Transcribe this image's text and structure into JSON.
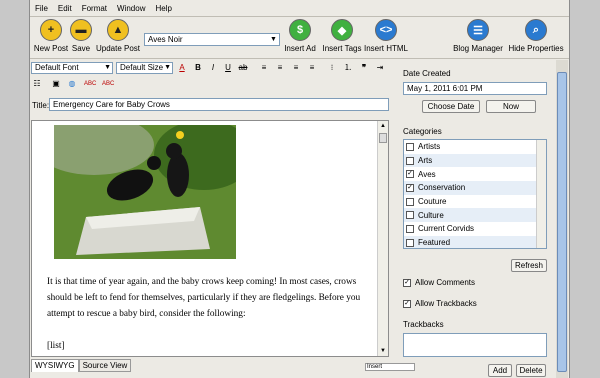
{
  "menu": [
    "File",
    "Edit",
    "Format",
    "Window",
    "Help"
  ],
  "toolbar": {
    "new_post": "New Post",
    "save": "Save",
    "update_post": "Update Post",
    "blog_name": "Aves Noir",
    "insert_ad": "Insert Ad",
    "insert_tags": "Insert Tags",
    "insert_html": "Insert HTML",
    "blog_manager": "Blog Manager",
    "hide_properties": "Hide Properties"
  },
  "format": {
    "font": "Default Font",
    "size": "Default Size"
  },
  "title": {
    "label": "Title:",
    "value": "Emergency Care for Baby Crows"
  },
  "editor": {
    "p1": "It is that time of year again, and the baby crows keep coming! In most cases, crows should be left to fend for themselves, particularly if they are fledgelings. Before you attempt to rescue a baby bird, consider the following:",
    "p2": "[list]"
  },
  "tabs": {
    "wysiwyg": "WYSIWYG",
    "source": "Source View"
  },
  "status": "Insert",
  "props": {
    "date_label": "Date Created",
    "date_value": "May 1, 2011 6:01 PM",
    "choose_date": "Choose Date",
    "now": "Now",
    "categories_label": "Categories",
    "categories": [
      {
        "name": "Artists",
        "checked": ""
      },
      {
        "name": "Arts",
        "checked": ""
      },
      {
        "name": "Aves",
        "checked": "✓"
      },
      {
        "name": "Conservation",
        "checked": "✓"
      },
      {
        "name": "Couture",
        "checked": ""
      },
      {
        "name": "Culture",
        "checked": ""
      },
      {
        "name": "Current Corvids",
        "checked": ""
      },
      {
        "name": "Featured",
        "checked": ""
      }
    ],
    "refresh": "Refresh",
    "allow_comments": "Allow Comments",
    "allow_trackbacks": "Allow Trackbacks",
    "trackbacks_label": "Trackbacks",
    "add": "Add",
    "delete": "Delete"
  },
  "colors": {
    "accent": "#a8c5e8",
    "icon_yellow": "#f0c020",
    "icon_green": "#40b040",
    "icon_blue": "#2a7ad0"
  }
}
